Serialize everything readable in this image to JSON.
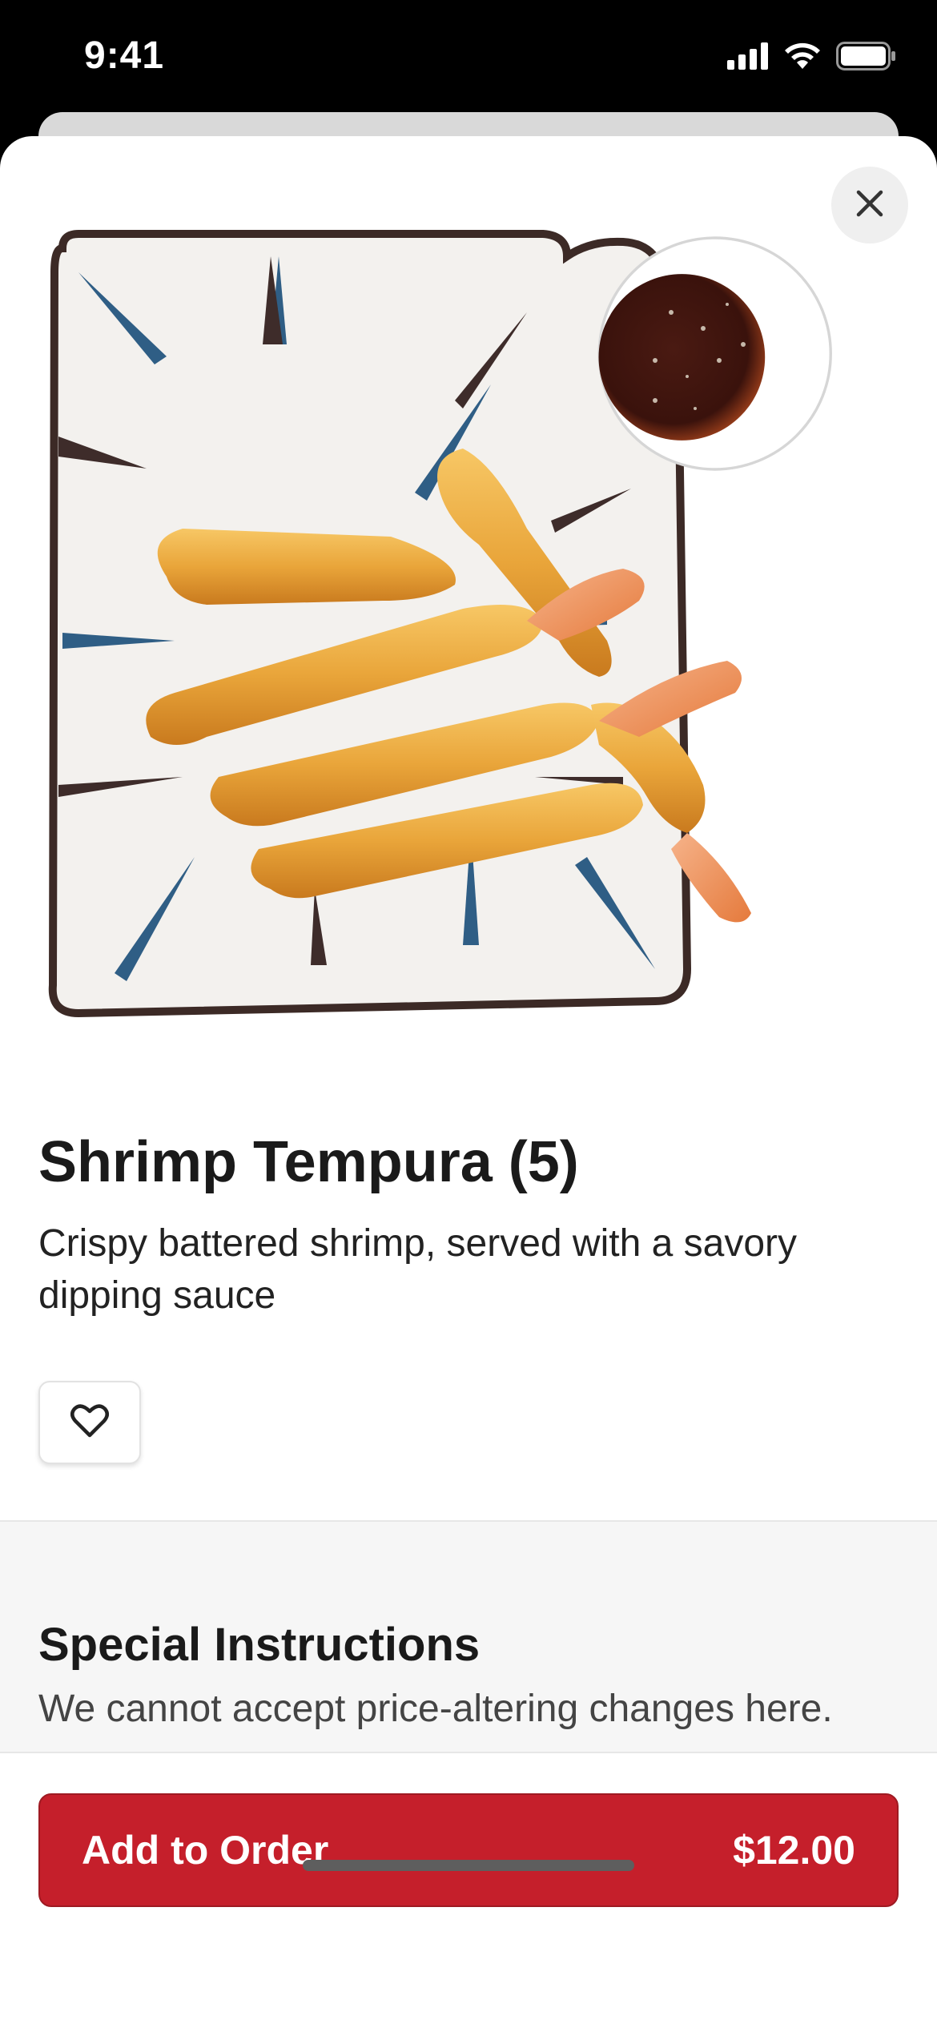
{
  "status_bar": {
    "time": "9:41",
    "icons": [
      "signal-icon",
      "wifi-icon",
      "battery-icon"
    ]
  },
  "item": {
    "image_alt": "Shrimp tempura on a square plate with dipping sauce",
    "title": "Shrimp Tempura (5)",
    "description": "Crispy battered shrimp, served with a savory dipping sauce"
  },
  "actions": {
    "close_icon": "close-icon",
    "favorite_icon": "heart-icon"
  },
  "special_instructions": {
    "title": "Special Instructions",
    "subtitle": "We cannot accept price-altering changes here."
  },
  "footer": {
    "add_label": "Add to Order",
    "price": "$12.00"
  },
  "colors": {
    "accent": "#c51f2b",
    "background": "#ffffff",
    "section_bg": "#f6f6f6"
  }
}
